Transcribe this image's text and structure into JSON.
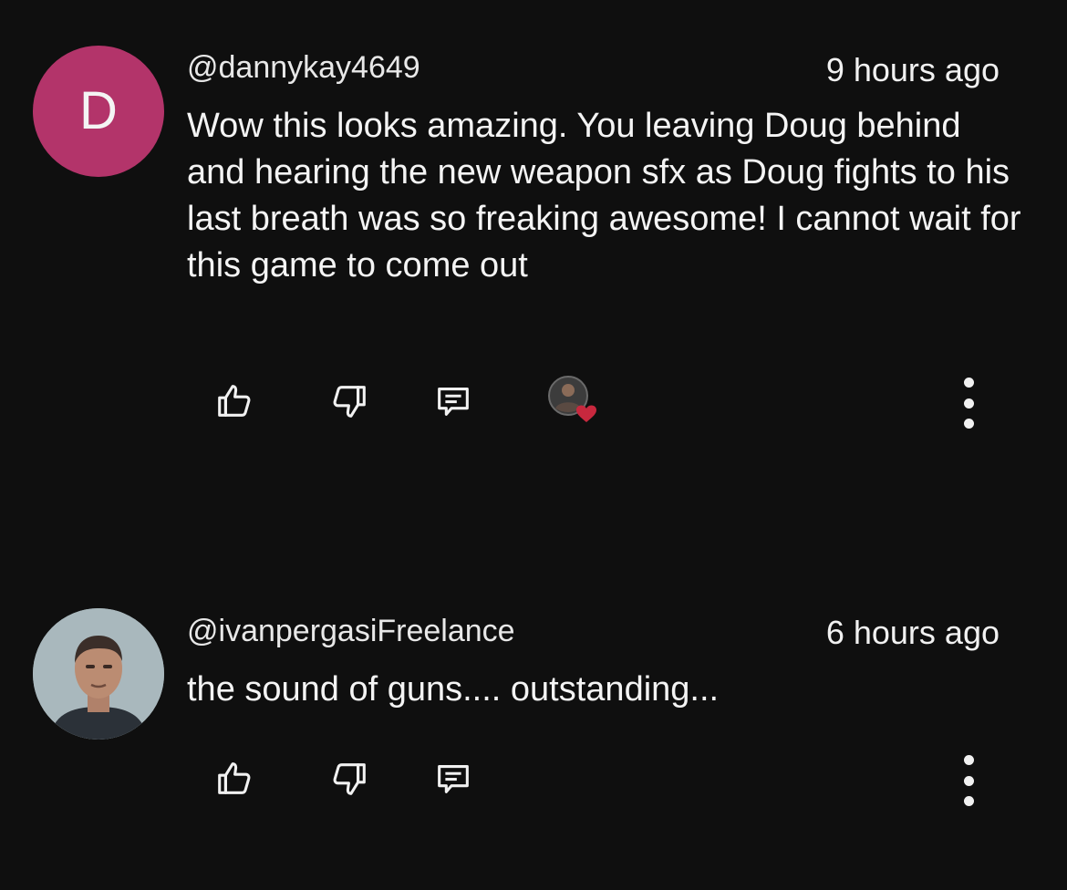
{
  "comments": [
    {
      "avatar_letter": "D",
      "avatar_color": "#b3346a",
      "handle": "@dannykay4649",
      "time": "9 hours ago",
      "text": "Wow this looks amazing. You leaving Doug behind and hearing the new weapon sfx as Doug fights to his last breath was so freaking awesome! I cannot wait for this game to come out",
      "creator_heart": true,
      "icons": [
        "thumb-up-icon",
        "thumb-down-icon",
        "reply-icon",
        "creator-heart-icon",
        "more-vert-icon"
      ]
    },
    {
      "avatar_letter": "",
      "avatar_color": "#a9b8bd",
      "handle": "@ivanpergasiFreelance",
      "time": "6 hours ago",
      "text": "the sound of guns.... outstanding...",
      "creator_heart": false,
      "icons": [
        "thumb-up-icon",
        "thumb-down-icon",
        "reply-icon",
        "more-vert-icon"
      ]
    }
  ],
  "colors": {
    "background": "#0f0f0f",
    "text": "#f1f1f1",
    "heart": "#c8283e"
  }
}
